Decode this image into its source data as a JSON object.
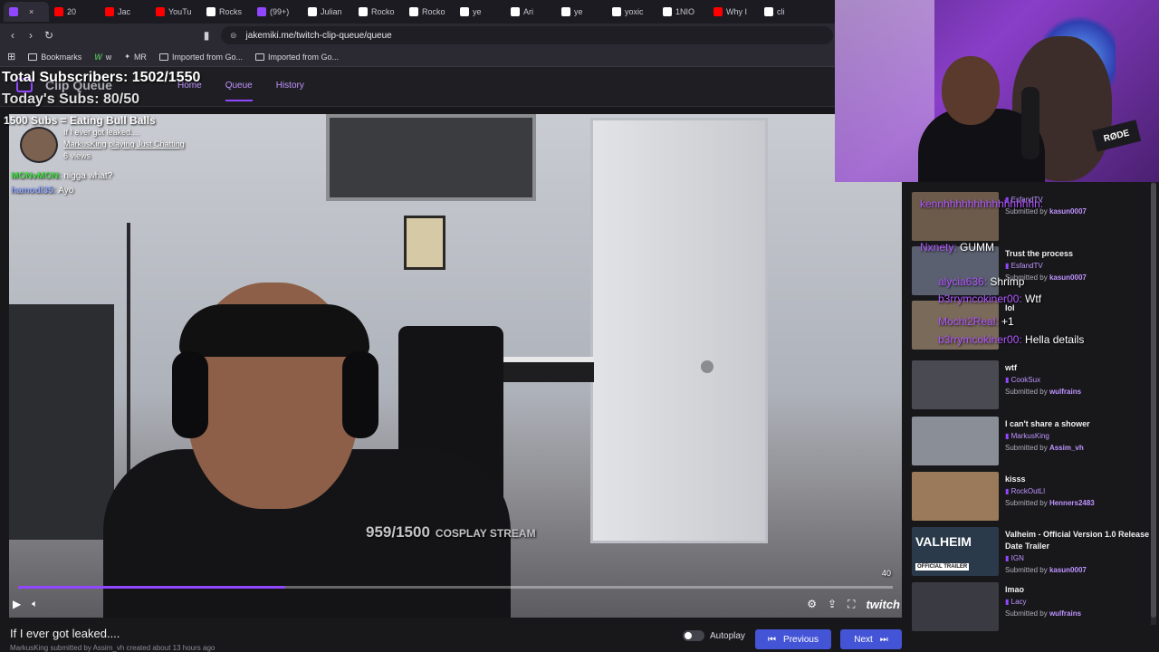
{
  "browser": {
    "tabs": [
      {
        "label": "",
        "color": "#9147ff",
        "active": true
      },
      {
        "label": "20",
        "color": "#ff0000"
      },
      {
        "label": "Jac",
        "color": "#ff0000"
      },
      {
        "label": "YouTu",
        "color": "#ff0000"
      },
      {
        "label": "Rocks",
        "color": "#ffffff"
      },
      {
        "label": "(99+)",
        "color": "#9147ff"
      },
      {
        "label": "Julian",
        "color": "#ffffff"
      },
      {
        "label": "Rocko",
        "color": "#ffffff"
      },
      {
        "label": "Rocko",
        "color": "#ffffff"
      },
      {
        "label": "ye",
        "color": "#ffffff"
      },
      {
        "label": "Ari",
        "color": "#ffffff"
      },
      {
        "label": "ye",
        "color": "#ffffff"
      },
      {
        "label": "yoxic",
        "color": "#ffffff"
      },
      {
        "label": "1NIO",
        "color": "#ffffff"
      },
      {
        "label": "Why I",
        "color": "#ff0000"
      },
      {
        "label": "cli",
        "color": "#ffffff"
      }
    ],
    "url": "jakemiki.me/twitch-clip-queue/queue",
    "bookmarks": [
      {
        "label": "Bookmarks"
      },
      {
        "label": "w"
      },
      {
        "label": "MR"
      },
      {
        "label": "Imported from Go..."
      },
      {
        "label": "Imported from Go..."
      }
    ]
  },
  "app": {
    "brand": "Clip Queue",
    "nav": [
      {
        "label": "Home"
      },
      {
        "label": "Queue",
        "current": true
      },
      {
        "label": "History"
      }
    ]
  },
  "overlay": {
    "total_subs": "Total Subscribers: 1502/1550",
    "today_subs": "Today's Subs: 80/50",
    "goal_text": "1500 Subs = Eating Bull Balls",
    "subgoal_main": "959/1500",
    "subgoal_label": "COSPLAY STREAM"
  },
  "clip": {
    "title": "If I ever got leaked....",
    "creator": "MarkusKing",
    "playing": "playing Just Chatting",
    "views": "6 views",
    "counter": "40",
    "progress": 0.305,
    "bottom_sub": "MarkusKing  submitted by Assim_vh  created about 13 hours ago"
  },
  "stream_chat": [
    {
      "name": "MONvMON:",
      "msg": "nigga what?",
      "color": "green"
    },
    {
      "name": "hamodi35:",
      "msg": "Ayo",
      "color": "blue"
    }
  ],
  "controls": {
    "autoplay_label": "Autoplay",
    "previous_label": "Previous",
    "next_label": "Next",
    "twitch_label": "twitch"
  },
  "overlay_chat": [
    {
      "name": "kennhhhhhhhhhhhhhhhh:",
      "msg": ""
    },
    {
      "name": "Nxnety:",
      "msg": "GUMM"
    },
    {
      "name": "alycia636:",
      "msg": "Shrimp"
    },
    {
      "name": "b3rrymcokiner00:",
      "msg": "Wtf"
    },
    {
      "name": "Mochi2Real:",
      "msg": "+1"
    },
    {
      "name": "b3rrymcokiner00:",
      "msg": "Hella details"
    }
  ],
  "queue": [
    {
      "title": "",
      "channel": "EsfandTV",
      "submitter": "kasun0007",
      "color": "#6c5a4a"
    },
    {
      "title": "Trust the process",
      "channel": "EsfandTV",
      "submitter": "kasun0007",
      "color": "#5a6070"
    },
    {
      "title": "lol",
      "channel": "",
      "submitter": "",
      "color": "#7a6a5a"
    },
    {
      "title": "wtf",
      "channel": "CookSux",
      "submitter": "wulfrains",
      "color": "#4a4a52"
    },
    {
      "title": "I can't share a shower",
      "channel": "MarkusKing",
      "submitter": "Assim_vh",
      "color": "#8a8e96"
    },
    {
      "title": "kisss",
      "channel": "RockOutLl",
      "submitter": "Henners2483",
      "color": "#9a7a5a"
    },
    {
      "title": "Valheim - Official Version 1.0 Release Date Trailer",
      "channel": "IGN",
      "submitter": "kasun0007",
      "color": "#2a3a4a",
      "badge": "OFFICIAL TRAILER",
      "logo": "VALHEIM"
    },
    {
      "title": "lmao",
      "channel": "Lacy",
      "submitter": "wulfrains",
      "color": "#3a3a42"
    }
  ],
  "labels": {
    "submitted_by": "Submitted by"
  }
}
